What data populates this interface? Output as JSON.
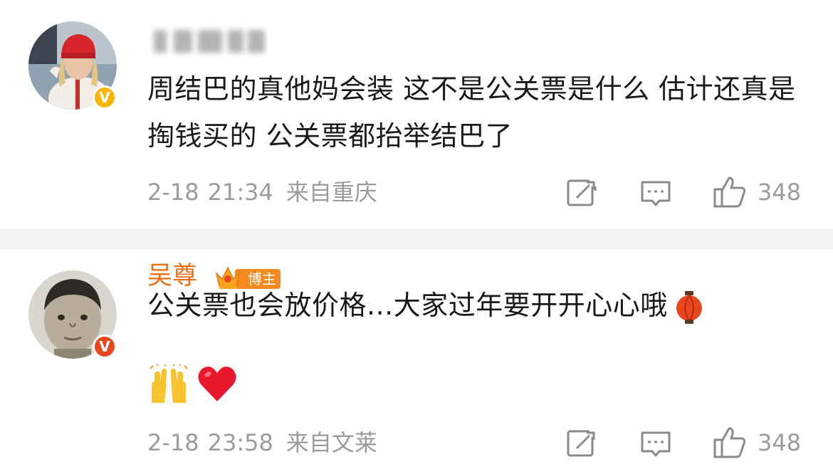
{
  "comments": [
    {
      "username": "",
      "username_blurred": true,
      "verified_badge": "v-badge-yellow",
      "badge_color": "#f7b500",
      "avatar_icon": "avatar-woman-red-beanie",
      "text": "周结巴的真他妈会装 这不是公关票是什么 估计还真是掏钱买的 公关票都抬举结巴了",
      "date": "2-18",
      "time": "21:34",
      "location": "来自重庆",
      "likes": "348"
    },
    {
      "username": "吴尊",
      "username_color": "#f26d0f",
      "blogger_tag": "博主",
      "verified_badge": "v-badge-red",
      "badge_color": "#e8471d",
      "avatar_icon": "avatar-child-photo",
      "text": "公关票也会放价格...大家过年要开开心心哦",
      "emojis": [
        "lantern-emoji",
        "raising-hands-emoji",
        "red-heart-emoji"
      ],
      "date": "2-18",
      "time": "23:58",
      "location": "来自文莱",
      "likes": "348"
    }
  ],
  "icons": {
    "share": "share-icon",
    "reply": "comment-icon",
    "like": "thumbs-up-icon"
  },
  "colors": {
    "divider": "#f2f2f2",
    "meta_text": "#9b9b9b",
    "body_text": "#1a1a1a",
    "accent_orange": "#f26d0f"
  }
}
